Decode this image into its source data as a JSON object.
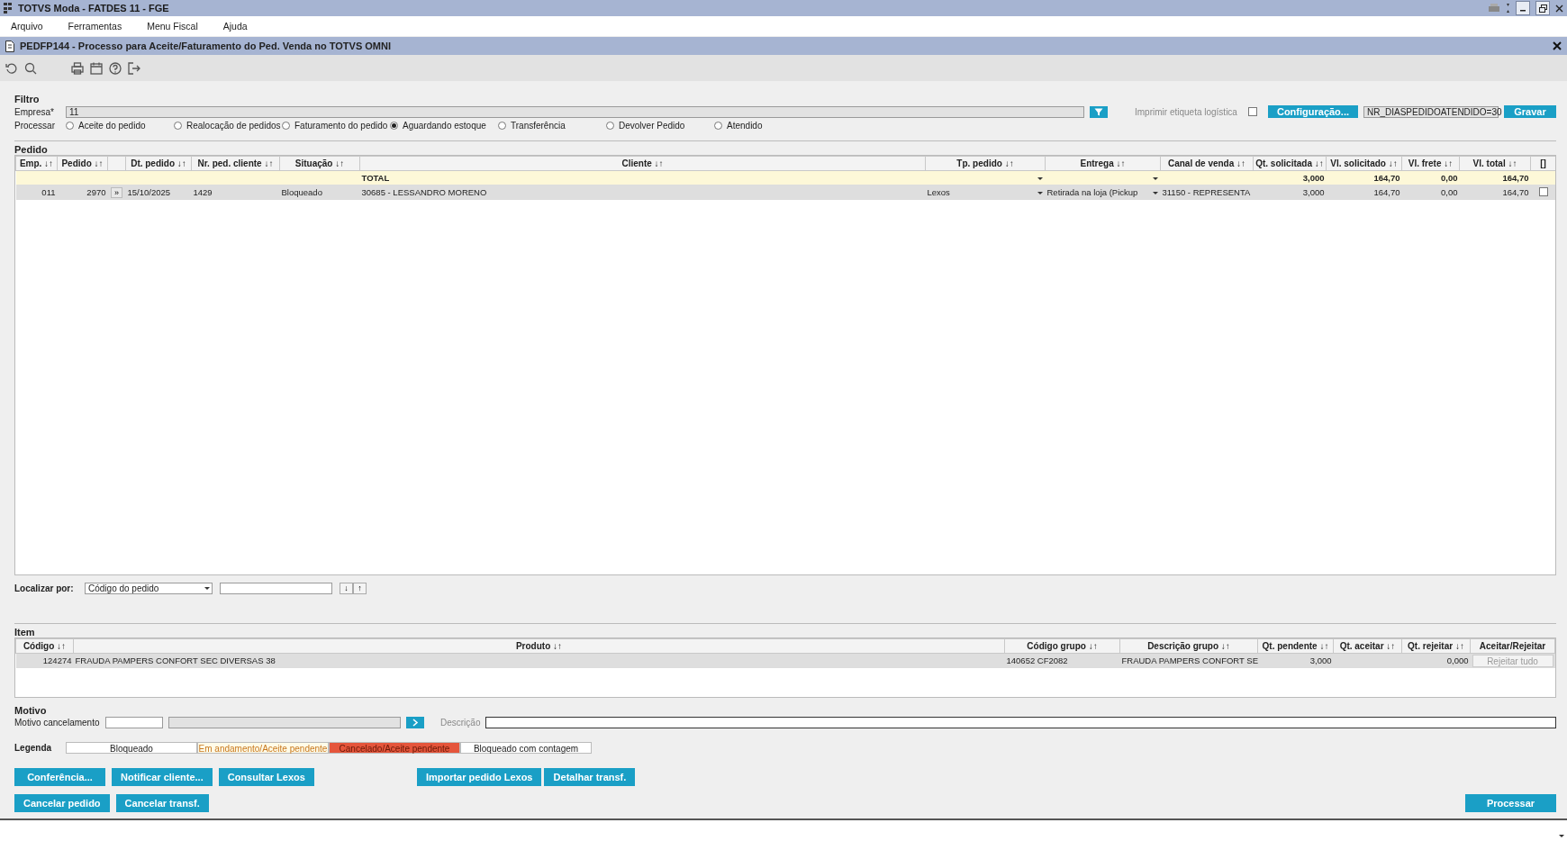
{
  "window": {
    "title": "TOTVS Moda - FATDES 11 - FGE"
  },
  "menu": [
    "Arquivo",
    "Ferramentas",
    "Menu Fiscal",
    "Ajuda"
  ],
  "form": {
    "title": "PEDFP144 - Processo para Aceite/Faturamento do Ped. Venda no TOTVS OMNI"
  },
  "filter": {
    "heading": "Filtro",
    "empresa_label": "Empresa*",
    "empresa_value": "11",
    "print_label": "Imprimir etiqueta logística",
    "print_checked": false,
    "config_button": "Configuração...",
    "config_value": "NR_DIASPEDIDOATENDIDO=30",
    "save_button": "Gravar",
    "process_label": "Processar",
    "process_options": [
      {
        "label": "Aceite do pedido",
        "selected": false
      },
      {
        "label": "Realocação de pedidos",
        "selected": false
      },
      {
        "label": "Faturamento do pedido",
        "selected": false
      },
      {
        "label": "Aguardando estoque",
        "selected": true
      },
      {
        "label": "Transferência",
        "selected": false
      },
      {
        "label": "Devolver Pedido",
        "selected": false
      },
      {
        "label": "Atendido",
        "selected": false
      }
    ]
  },
  "orders": {
    "heading": "Pedido",
    "columns": [
      "Emp. ↓↑",
      "Pedido ↓↑",
      "",
      "Dt. pedido ↓↑",
      "Nr. ped. cliente ↓↑",
      "Situação ↓↑",
      "Cliente ↓↑",
      "Tp. pedido ↓↑",
      "Entrega ↓↑",
      "Canal de venda ↓↑",
      "Qt. solicitada ↓↑",
      "Vl. solicitado ↓↑",
      "Vl. frete ↓↑",
      "Vl. total ↓↑",
      "[]"
    ],
    "total_row": [
      {
        "kind": "blank"
      },
      {
        "kind": "blank"
      },
      {
        "kind": "blank"
      },
      {
        "kind": "blank"
      },
      {
        "kind": "blank"
      },
      {
        "kind": "blank"
      },
      {
        "kind": "label",
        "text": "TOTAL"
      },
      {
        "kind": "select"
      },
      {
        "kind": "select"
      },
      {
        "kind": "blank"
      },
      {
        "kind": "number",
        "text": "3,000"
      },
      {
        "kind": "number",
        "text": "164,70"
      },
      {
        "kind": "number",
        "text": "0,00"
      },
      {
        "kind": "number",
        "text": "164,70"
      },
      {
        "kind": "blank"
      }
    ],
    "rows": [
      {
        "selected": true,
        "cells": [
          {
            "kind": "number",
            "text": "011"
          },
          {
            "kind": "number",
            "text": "2970"
          },
          {
            "kind": "expand",
            "text": "»"
          },
          {
            "kind": "text",
            "text": "15/10/2025"
          },
          {
            "kind": "text",
            "text": "1429"
          },
          {
            "kind": "text",
            "text": "Bloqueado"
          },
          {
            "kind": "text",
            "text": "30685 - LESSANDRO MORENO"
          },
          {
            "kind": "select",
            "text": "Lexos"
          },
          {
            "kind": "select",
            "text": "Retirada na loja (Pickup"
          },
          {
            "kind": "text",
            "text": "31150 - REPRESENTA"
          },
          {
            "kind": "number",
            "text": "3,000"
          },
          {
            "kind": "number",
            "text": "164,70"
          },
          {
            "kind": "number",
            "text": "0,00"
          },
          {
            "kind": "number",
            "text": "164,70"
          },
          {
            "kind": "checkbox",
            "checked": false
          }
        ]
      }
    ]
  },
  "locate": {
    "label": "Localizar por:",
    "by_value": "Código do pedido",
    "down_button": "↓",
    "up_button": "↑"
  },
  "items": {
    "heading": "Item",
    "columns": [
      "Código ↓↑",
      "Produto ↓↑",
      "Código grupo ↓↑",
      "Descrição grupo ↓↑",
      "Qt. pendente ↓↑",
      "Qt. aceitar ↓↑",
      "Qt. rejeitar ↓↑",
      "Aceitar/Rejeitar"
    ],
    "rows": [
      {
        "selected": true,
        "cells": [
          {
            "kind": "number",
            "text": "124274"
          },
          {
            "kind": "text",
            "text": "FRAUDA PAMPERS CONFORT SEC DIVERSAS 38"
          },
          {
            "kind": "text",
            "text": "140652 CF2082"
          },
          {
            "kind": "text",
            "text": "FRAUDA PAMPERS CONFORT SE"
          },
          {
            "kind": "number",
            "text": "3,000"
          },
          {
            "kind": "blank"
          },
          {
            "kind": "number",
            "text": "0,000"
          },
          {
            "kind": "button",
            "text": "Rejeitar tudo",
            "disabled": true
          }
        ]
      }
    ]
  },
  "reason": {
    "heading": "Motivo",
    "label": "Motivo cancelamento",
    "description_label": "Descrição"
  },
  "legend": {
    "label": "Legenda",
    "items": [
      {
        "text": "Bloqueado",
        "color": "#ffffff",
        "kind": "plain"
      },
      {
        "text": "Em andamento/Aceite pendente",
        "color": "#fffbe8",
        "kind": "pending"
      },
      {
        "text": "Cancelado/Aceite pendente",
        "color": "#e5553b",
        "kind": "cancelled"
      },
      {
        "text": "Bloqueado com contagem",
        "color": "#ffffff",
        "kind": "plain"
      }
    ]
  },
  "action_rows": [
    {
      "left": [
        "Conferência...",
        "Notificar cliente...",
        "Consultar Lexos"
      ],
      "center": [
        "Importar pedido Lexos",
        "Detalhar transf."
      ]
    },
    {
      "left": [
        "Cancelar pedido",
        "Cancelar transf."
      ],
      "right": [
        "Processar"
      ]
    }
  ]
}
